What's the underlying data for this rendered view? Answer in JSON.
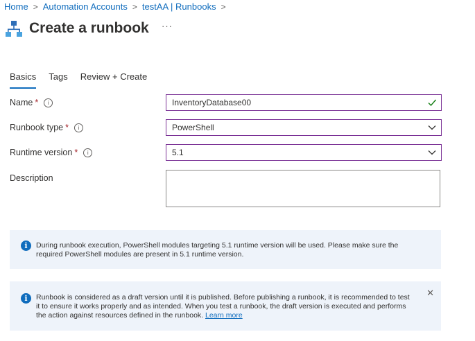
{
  "breadcrumb": [
    "Home",
    "Automation Accounts",
    "testAA | Runbooks"
  ],
  "page": {
    "title": "Create a runbook",
    "more": "···"
  },
  "tabs": [
    {
      "label": "Basics",
      "active": true
    },
    {
      "label": "Tags",
      "active": false
    },
    {
      "label": "Review + Create",
      "active": false
    }
  ],
  "form": {
    "name": {
      "label": "Name",
      "required": "*",
      "value": "InventoryDatabase00",
      "valid": true
    },
    "runbook_type": {
      "label": "Runbook type",
      "required": "*",
      "value": "PowerShell"
    },
    "runtime_version": {
      "label": "Runtime version",
      "required": "*",
      "value": "5.1"
    },
    "description": {
      "label": "Description",
      "value": ""
    }
  },
  "info_runtime": {
    "line1": "During runbook execution, PowerShell modules targeting 5.1 runtime version will be used. Please make sure the",
    "line2": "required PowerShell modules are present in 5.1 runtime version."
  },
  "info_draft": {
    "line1": "Runbook is considered as a draft version until it is published. Before publishing a runbook, it is recommended to test",
    "line2": "it to ensure it works properly and as intended. When you test a runbook, the draft version is executed and performs",
    "line3": "the action against resources defined in the runbook.",
    "link": "Learn more"
  },
  "colors": {
    "accent": "#0f6cbd",
    "field_border": "#7b3296",
    "valid": "#107c10",
    "required": "#a4262c",
    "info_bg": "#eef3fa"
  }
}
